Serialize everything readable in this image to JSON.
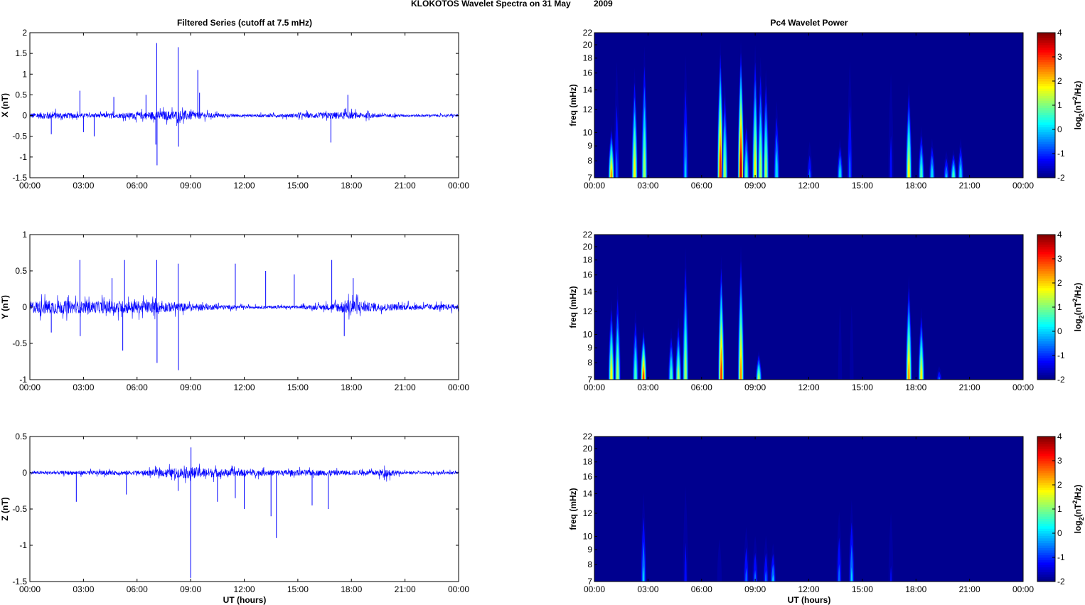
{
  "title": "KLOKOTOS Wavelet Spectra on 31 May",
  "year": "2009",
  "left_title": "Filtered Series (cutoff at 7.5 mHz)",
  "right_title": "Pc4 Wavelet Power",
  "xlabel": "UT (hours)",
  "colorbar_label": "log2(nT^2/Hz)",
  "chart_data": [
    {
      "type": "line",
      "component": "X",
      "ylabel": "X (nT)",
      "ylim": [
        -1.5,
        2
      ],
      "yticks": [
        "-1.5",
        "-1",
        "-0.5",
        "0",
        "0.5",
        "1",
        "1.5",
        "2"
      ],
      "ytick_values": [
        -1.5,
        -1,
        -0.5,
        0,
        0.5,
        1,
        1.5,
        2
      ],
      "xticks": [
        "00:00",
        "03:00",
        "06:00",
        "09:00",
        "12:00",
        "15:00",
        "18:00",
        "21:00",
        "00:00"
      ],
      "activity": [
        [
          0,
          0.06
        ],
        [
          1,
          0.09
        ],
        [
          3,
          0.05
        ],
        [
          5,
          0.06
        ],
        [
          7,
          0.1
        ],
        [
          8.5,
          0.13
        ],
        [
          10,
          0.06
        ],
        [
          12,
          0.03
        ],
        [
          14,
          0.04
        ],
        [
          17.5,
          0.09
        ],
        [
          19,
          0.06
        ],
        [
          21,
          0.03
        ],
        [
          24,
          0.03
        ]
      ],
      "spikes": [
        [
          7.1,
          1.75
        ],
        [
          7.12,
          -1.2
        ],
        [
          7.05,
          -0.7
        ],
        [
          8.3,
          1.65
        ],
        [
          8.32,
          -0.75
        ],
        [
          9.4,
          1.1
        ],
        [
          9.5,
          0.55
        ],
        [
          6.5,
          0.5
        ],
        [
          3.0,
          -0.4
        ],
        [
          2.8,
          0.6
        ],
        [
          16.85,
          -0.65
        ],
        [
          17.8,
          0.5
        ],
        [
          4.7,
          0.45
        ],
        [
          3.6,
          -0.5
        ],
        [
          1.2,
          -0.45
        ]
      ]
    },
    {
      "type": "line",
      "component": "Y",
      "ylabel": "Y (nT)",
      "ylim": [
        -1,
        1
      ],
      "yticks": [
        "-1",
        "-0.5",
        "0",
        "0.5",
        "1"
      ],
      "ytick_values": [
        -1,
        -0.5,
        0,
        0.5,
        1
      ],
      "xticks": [
        "00:00",
        "03:00",
        "06:00",
        "09:00",
        "12:00",
        "15:00",
        "18:00",
        "21:00",
        "00:00"
      ],
      "activity": [
        [
          0,
          0.08
        ],
        [
          1,
          0.1
        ],
        [
          3,
          0.08
        ],
        [
          5,
          0.09
        ],
        [
          7,
          0.08
        ],
        [
          9,
          0.05
        ],
        [
          12,
          0.02
        ],
        [
          15,
          0.02
        ],
        [
          17,
          0.05
        ],
        [
          18,
          0.12
        ],
        [
          19,
          0.06
        ],
        [
          21,
          0.04
        ],
        [
          24,
          0.04
        ]
      ],
      "spikes": [
        [
          7.1,
          0.65
        ],
        [
          7.12,
          -0.77
        ],
        [
          8.3,
          0.6
        ],
        [
          8.32,
          -0.87
        ],
        [
          5.3,
          0.65
        ],
        [
          5.2,
          -0.6
        ],
        [
          2.8,
          0.65
        ],
        [
          2.82,
          -0.4
        ],
        [
          1.2,
          -0.35
        ],
        [
          11.5,
          0.6
        ],
        [
          13.2,
          0.5
        ],
        [
          14.8,
          0.45
        ],
        [
          16.9,
          0.65
        ],
        [
          18.1,
          0.4
        ],
        [
          4.6,
          0.4
        ],
        [
          17.6,
          -0.4
        ]
      ]
    },
    {
      "type": "line",
      "component": "Z",
      "ylabel": "Z (nT)",
      "ylim": [
        -1.5,
        0.5
      ],
      "yticks": [
        "-1.5",
        "-1",
        "-0.5",
        "0",
        "0.5"
      ],
      "ytick_values": [
        -1.5,
        -1,
        -0.5,
        0,
        0.5
      ],
      "xticks": [
        "00:00",
        "03:00",
        "06:00",
        "09:00",
        "12:00",
        "15:00",
        "18:00",
        "21:00",
        "00:00"
      ],
      "activity": [
        [
          0,
          0.02
        ],
        [
          3,
          0.03
        ],
        [
          6,
          0.03
        ],
        [
          8,
          0.06
        ],
        [
          9,
          0.08
        ],
        [
          11,
          0.05
        ],
        [
          13,
          0.04
        ],
        [
          16,
          0.04
        ],
        [
          19,
          0.03
        ],
        [
          20,
          0.06
        ],
        [
          20.8,
          0.02
        ],
        [
          24,
          0.02
        ]
      ],
      "spikes": [
        [
          9.0,
          -1.45
        ],
        [
          9.02,
          0.35
        ],
        [
          13.8,
          -0.9
        ],
        [
          13.5,
          -0.6
        ],
        [
          8.3,
          -0.25
        ],
        [
          5.4,
          -0.3
        ],
        [
          2.6,
          -0.4
        ],
        [
          12.0,
          -0.5
        ],
        [
          15.8,
          -0.45
        ],
        [
          16.7,
          -0.5
        ],
        [
          10.5,
          -0.4
        ],
        [
          11.5,
          -0.35
        ]
      ]
    },
    {
      "type": "heatmap",
      "component": "X",
      "ylabel": "freq (mHz)",
      "ylim": [
        7,
        22
      ],
      "yscale": "log",
      "yticks": [
        "7",
        "8",
        "9",
        "10",
        "12",
        "14",
        "16",
        "18",
        "20",
        "22"
      ],
      "ytick_values": [
        7,
        8,
        9,
        10,
        12,
        14,
        16,
        18,
        20,
        22
      ],
      "xticks": [
        "00:00",
        "03:00",
        "06:00",
        "09:00",
        "12:00",
        "15:00",
        "18:00",
        "21:00",
        "00:00"
      ],
      "clim": [
        -2,
        4
      ],
      "cticks": [
        "-2",
        "-1",
        "0",
        "1",
        "2",
        "3",
        "4"
      ],
      "bursts": [
        [
          0.95,
          11,
          2.5
        ],
        [
          1.25,
          22,
          -0.5
        ],
        [
          2.25,
          18,
          2
        ],
        [
          2.8,
          22,
          1.5
        ],
        [
          5.1,
          22,
          0
        ],
        [
          7.05,
          22,
          3.5
        ],
        [
          7.3,
          16,
          1.5
        ],
        [
          8.2,
          22,
          4
        ],
        [
          8.5,
          12,
          1
        ],
        [
          9.0,
          22,
          2
        ],
        [
          9.3,
          20,
          1.5
        ],
        [
          9.6,
          18,
          1.5
        ],
        [
          10.2,
          14,
          0.5
        ],
        [
          12.05,
          10,
          -0.5
        ],
        [
          13.75,
          10,
          0.5
        ],
        [
          14.3,
          22,
          -0.5
        ],
        [
          16.6,
          22,
          -1
        ],
        [
          17.6,
          16,
          2
        ],
        [
          18.3,
          11,
          1
        ],
        [
          18.9,
          10,
          0.5
        ],
        [
          19.7,
          9,
          0
        ],
        [
          20.1,
          9,
          1
        ],
        [
          20.5,
          10,
          0.5
        ]
      ]
    },
    {
      "type": "heatmap",
      "component": "Y",
      "ylabel": "freq (mHz)",
      "ylim": [
        7,
        22
      ],
      "yscale": "log",
      "yticks": [
        "7",
        "8",
        "9",
        "10",
        "12",
        "14",
        "16",
        "18",
        "20",
        "22"
      ],
      "ytick_values": [
        7,
        8,
        9,
        10,
        12,
        14,
        16,
        18,
        20,
        22
      ],
      "xticks": [
        "00:00",
        "03:00",
        "06:00",
        "09:00",
        "12:00",
        "15:00",
        "18:00",
        "21:00",
        "00:00"
      ],
      "clim": [
        -2,
        4
      ],
      "cticks": [
        "-2",
        "-1",
        "0",
        "1",
        "2",
        "3",
        "4"
      ],
      "bursts": [
        [
          0.95,
          14,
          2
        ],
        [
          1.3,
          16,
          1.5
        ],
        [
          2.3,
          13,
          1
        ],
        [
          2.75,
          11,
          3
        ],
        [
          4.3,
          11,
          1
        ],
        [
          4.7,
          12,
          1.5
        ],
        [
          5.1,
          22,
          1.5
        ],
        [
          7.1,
          20,
          3
        ],
        [
          8.2,
          22,
          2.5
        ],
        [
          9.2,
          9,
          1.5
        ],
        [
          13.75,
          22,
          -1.5
        ],
        [
          14.4,
          22,
          -1.5
        ],
        [
          17.6,
          17,
          2.5
        ],
        [
          18.3,
          13,
          2
        ],
        [
          19.3,
          8,
          -0.5
        ]
      ]
    },
    {
      "type": "heatmap",
      "component": "Z",
      "ylabel": "freq (mHz)",
      "ylim": [
        7,
        22
      ],
      "yscale": "log",
      "yticks": [
        "7",
        "8",
        "9",
        "10",
        "12",
        "14",
        "16",
        "18",
        "20",
        "22"
      ],
      "ytick_values": [
        7,
        8,
        9,
        10,
        12,
        14,
        16,
        18,
        20,
        22
      ],
      "xticks": [
        "00:00",
        "03:00",
        "06:00",
        "09:00",
        "12:00",
        "15:00",
        "18:00",
        "21:00",
        "00:00"
      ],
      "clim": [
        -2,
        4
      ],
      "cticks": [
        "-2",
        "-1",
        "0",
        "1",
        "2",
        "3",
        "4"
      ],
      "bursts": [
        [
          2.75,
          16,
          0
        ],
        [
          5.1,
          20,
          -1
        ],
        [
          7.0,
          12,
          -1.3
        ],
        [
          8.5,
          12,
          -0.5
        ],
        [
          9.0,
          11,
          -0.5
        ],
        [
          9.6,
          11,
          -0.5
        ],
        [
          10.0,
          10,
          0
        ],
        [
          13.7,
          14,
          -0.5
        ],
        [
          14.4,
          15,
          0
        ],
        [
          16.6,
          16,
          -1.2
        ]
      ]
    }
  ]
}
